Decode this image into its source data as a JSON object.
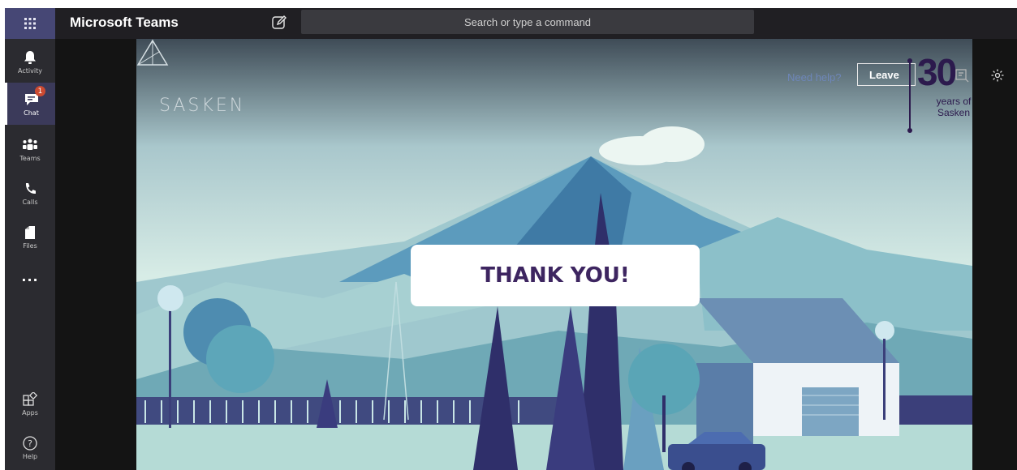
{
  "app": {
    "title": "Microsoft Teams"
  },
  "search": {
    "placeholder": "Search or type a command"
  },
  "rail": {
    "items": [
      {
        "label": "Activity",
        "icon": "bell-icon"
      },
      {
        "label": "Chat",
        "icon": "chat-icon",
        "badge": "1"
      },
      {
        "label": "Teams",
        "icon": "teams-icon"
      },
      {
        "label": "Calls",
        "icon": "phone-icon"
      },
      {
        "label": "Files",
        "icon": "file-icon"
      },
      {
        "label": "...",
        "icon": "more-icon"
      },
      {
        "label": "Apps",
        "icon": "apps-icon"
      },
      {
        "label": "Help",
        "icon": "help-icon"
      }
    ]
  },
  "stage": {
    "brand": "SASKEN",
    "need_help": "Need help?",
    "leave": "Leave",
    "anniversary_number": "30",
    "anniversary_line1": "years of",
    "anniversary_line2": "Sasken",
    "message": "THANK YOU!"
  },
  "colors": {
    "rail_bg": "#2b2b30",
    "topbar_bg": "#201f23",
    "accent": "#464775",
    "badge": "#cc4a31"
  }
}
